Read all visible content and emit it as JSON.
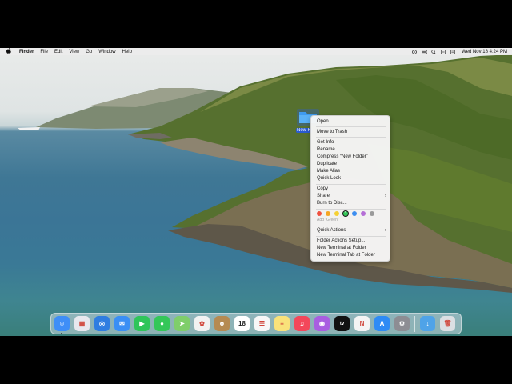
{
  "menubar": {
    "apple_icon": "apple-logo-icon",
    "app_name": "Finder",
    "menus": [
      "File",
      "Edit",
      "View",
      "Go",
      "Window",
      "Help"
    ],
    "status_icons": [
      "vpn-icon",
      "control-center-icon",
      "search-icon",
      "siri-icon",
      "notification-icon"
    ],
    "clock": "Wed Nov 18  4:24 PM"
  },
  "desktop": {
    "folder": {
      "label": "New F",
      "icon": "folder-icon"
    }
  },
  "context_menu": {
    "items": {
      "open": "Open",
      "move_to_trash": "Move to Trash",
      "get_info": "Get Info",
      "rename": "Rename",
      "compress": "Compress “New Folder”",
      "duplicate": "Duplicate",
      "make_alias": "Make Alias",
      "quick_look": "Quick Look",
      "copy": "Copy",
      "share": "Share",
      "burn": "Burn to Disc...",
      "add_tag": "Add “Green”",
      "quick_actions": "Quick Actions",
      "folder_actions": "Folder Actions Setup...",
      "new_terminal": "New Terminal at Folder",
      "new_terminal_tab": "New Terminal Tab at Folder"
    },
    "tag_colors": [
      "#f0513f",
      "#f5a623",
      "#f5d033",
      "#34c759",
      "#3d8ef0",
      "#b56ed6",
      "#9a9a9a"
    ],
    "selected_tag": "Green"
  },
  "dock": {
    "apps": [
      {
        "name": "finder",
        "color": "#3e8ef7",
        "glyph": "☺",
        "running": true
      },
      {
        "name": "launchpad",
        "color": "#e8e8ee",
        "glyph": "▦",
        "running": false
      },
      {
        "name": "safari",
        "color": "#2f7de1",
        "glyph": "◎",
        "running": false
      },
      {
        "name": "mail",
        "color": "#3a8ff5",
        "glyph": "✉",
        "running": false
      },
      {
        "name": "facetime",
        "color": "#2fc55a",
        "glyph": "▶",
        "running": false
      },
      {
        "name": "messages",
        "color": "#34c759",
        "glyph": "●",
        "running": false
      },
      {
        "name": "maps",
        "color": "#7fce6a",
        "glyph": "➤",
        "running": false
      },
      {
        "name": "photos",
        "color": "#f2f2f2",
        "glyph": "✿",
        "running": false
      },
      {
        "name": "contacts",
        "color": "#b58a52",
        "glyph": "☻",
        "running": false
      },
      {
        "name": "calendar",
        "color": "#ffffff",
        "glyph": "18",
        "running": false
      },
      {
        "name": "reminders",
        "color": "#f7f7f7",
        "glyph": "☰",
        "running": false
      },
      {
        "name": "notes",
        "color": "#f9e27a",
        "glyph": "≡",
        "running": false
      },
      {
        "name": "music",
        "color": "#f3475a",
        "glyph": "♫",
        "running": false
      },
      {
        "name": "podcasts",
        "color": "#a95ee1",
        "glyph": "◉",
        "running": false
      },
      {
        "name": "tv",
        "color": "#111111",
        "glyph": "tv",
        "running": false
      },
      {
        "name": "news",
        "color": "#f4f4f4",
        "glyph": "N",
        "running": false
      },
      {
        "name": "app-store",
        "color": "#2e8bf5",
        "glyph": "A",
        "running": false
      },
      {
        "name": "system-preferences",
        "color": "#8d8d93",
        "glyph": "⚙",
        "running": false
      }
    ],
    "right_apps": [
      {
        "name": "downloads-folder",
        "color": "#4fa3e8",
        "glyph": "↓"
      },
      {
        "name": "trash",
        "color": "#dcdfe3",
        "glyph": "🗑"
      }
    ]
  }
}
